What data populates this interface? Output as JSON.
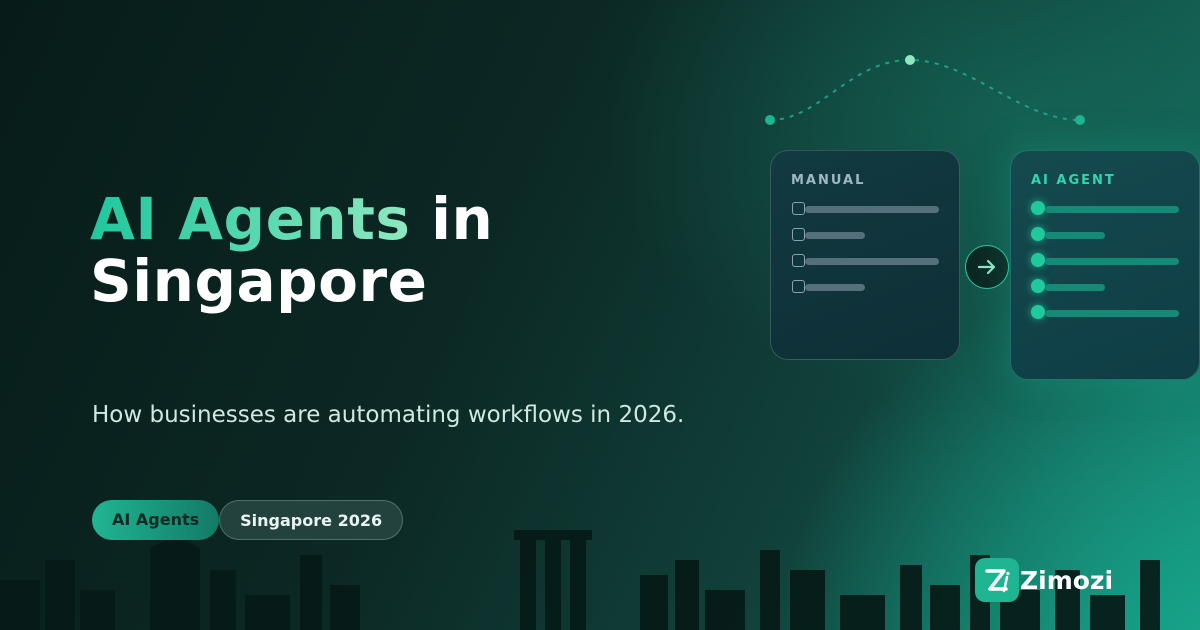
{
  "hero": {
    "title_accent": "AI Agents",
    "title_rest": " in",
    "title_line2": "Singapore",
    "subtitle": "How businesses are automating workflows in 2026."
  },
  "tags": [
    {
      "label": "AI Agents"
    },
    {
      "label": "Singapore 2026"
    }
  ],
  "cards": {
    "manual": {
      "title": "MANUAL"
    },
    "ai": {
      "title": "AI AGENT"
    }
  },
  "brand": {
    "name": "Zimozi",
    "accent_color": "#1fb593"
  },
  "icons": [
    "arrow-right-icon",
    "checkbox-icon",
    "status-dot-icon",
    "zimozi-logo-icon"
  ]
}
